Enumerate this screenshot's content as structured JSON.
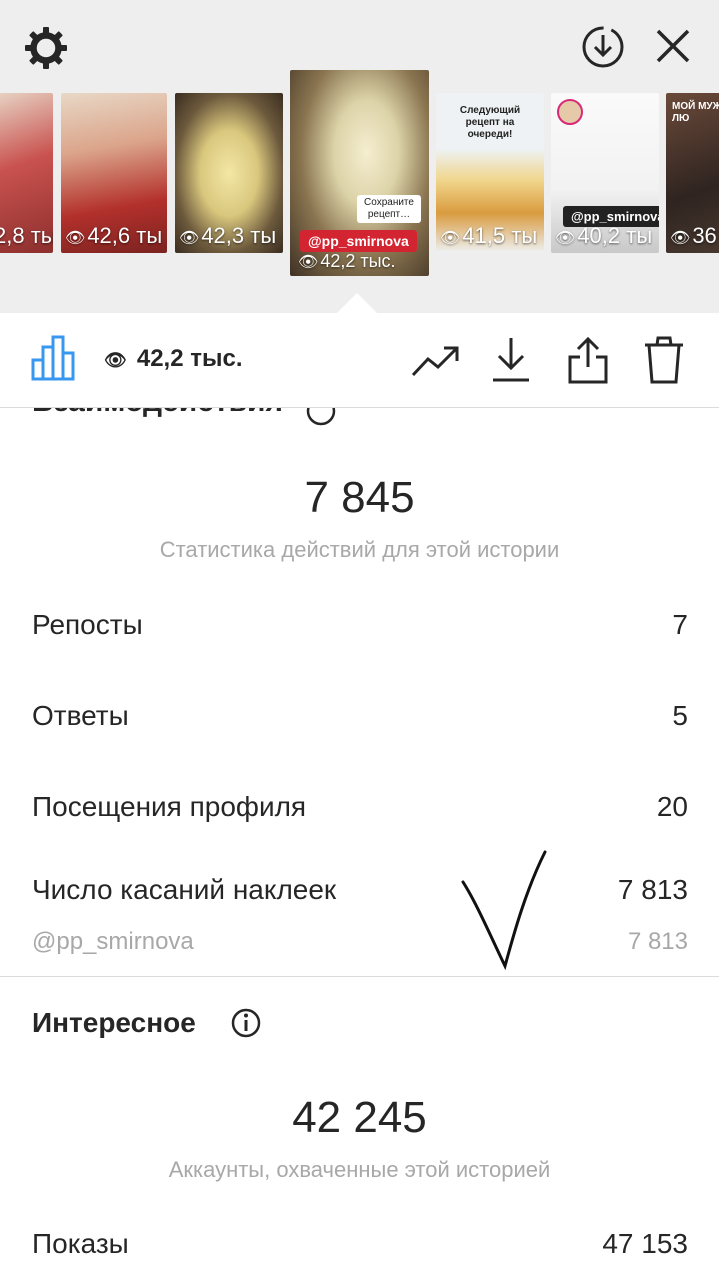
{
  "thumbnails": [
    {
      "views": "2,8 ты",
      "color": "#b35a5a"
    },
    {
      "views": "42,6 ты",
      "color": "#c46a5a"
    },
    {
      "views": "42,3 ты",
      "color": "#8a7a52"
    },
    {
      "views": "42,2 тыс.",
      "tag": "@pp_smirnova",
      "active": true,
      "color": "#8c7a5b"
    },
    {
      "views": "41,5 ты",
      "caption": "Следующий рецепт на очереди!",
      "color": "#e7ecef"
    },
    {
      "views": "40,2 ты",
      "tag": "@pp_smirnova",
      "color": "#f1f1f1"
    },
    {
      "views": "36",
      "caption": "МОЙ МУЖ ЛЮ",
      "color": "#3d2f28"
    }
  ],
  "toolbar": {
    "views": "42,2 тыс.",
    "icons": [
      "bar-chart-icon",
      "eye-icon",
      "trend-icon",
      "download-icon",
      "share-icon",
      "trash-icon"
    ],
    "accent": "#3897f0"
  },
  "interactions": {
    "title": "Взаимодействия",
    "total": "7 845",
    "subtitle": "Статистика действий для этой истории",
    "rows": [
      {
        "label": "Репосты",
        "value": "7"
      },
      {
        "label": "Ответы",
        "value": "5"
      },
      {
        "label": "Посещения профиля",
        "value": "20"
      },
      {
        "label": "Число касаний наклеек",
        "value": "7 813"
      },
      {
        "label": "@pp_smirnova",
        "value": "7 813"
      }
    ]
  },
  "discovery": {
    "title": "Интересное",
    "total": "42 245",
    "subtitle": "Аккаунты, охваченные этой историей",
    "rows": [
      {
        "label": "Показы",
        "value": "47 153"
      }
    ]
  }
}
